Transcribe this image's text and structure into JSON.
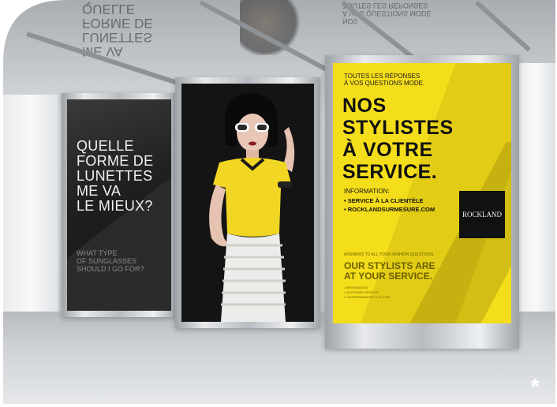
{
  "scene": {
    "description_colors": {
      "yellow": "#f4dd1a",
      "black": "#141414",
      "dark_panel": "#1f1f1f"
    }
  },
  "poster_left": {
    "french_question": "QUELLE\nFORME DE\nLUNETTES\nME VA\nLE MIEUX?",
    "english_question": "WHAT TYPE\nOF SUNGLASSES\nSHOULD I GO FOR?"
  },
  "poster_right": {
    "intro": "TOUTES LES RÉPONSES\nÀ VOS QUESTIONS MODE.",
    "headline": "NOS\nSTYLISTES\nÀ VOTRE\nSERVICE.",
    "info_label": "INFORMATION:",
    "bullets": [
      "• SERVICE À LA CLIENTÈLE",
      "• ROCKLANDSURMESURE.COM"
    ],
    "logo": "ROCKLAND",
    "small_intro": "ANSWERS TO ALL YOUR FASHION QUESTIONS.",
    "english_headline": "OUR STYLISTS ARE\nAT YOUR SERVICE.",
    "english_info": "• INFORMATION:\n• CUSTOMER SERVICE\n• TOURNEMUNEWSTYLE.COM"
  },
  "reflections": {
    "left": "ME VA\nLUNETTES\nFORME DE\nQUELLE",
    "right": "NOS\nÀ VOS QUESTIONS MODE\nTOUTES LES RÉPONSES"
  },
  "corner_mark": "*"
}
